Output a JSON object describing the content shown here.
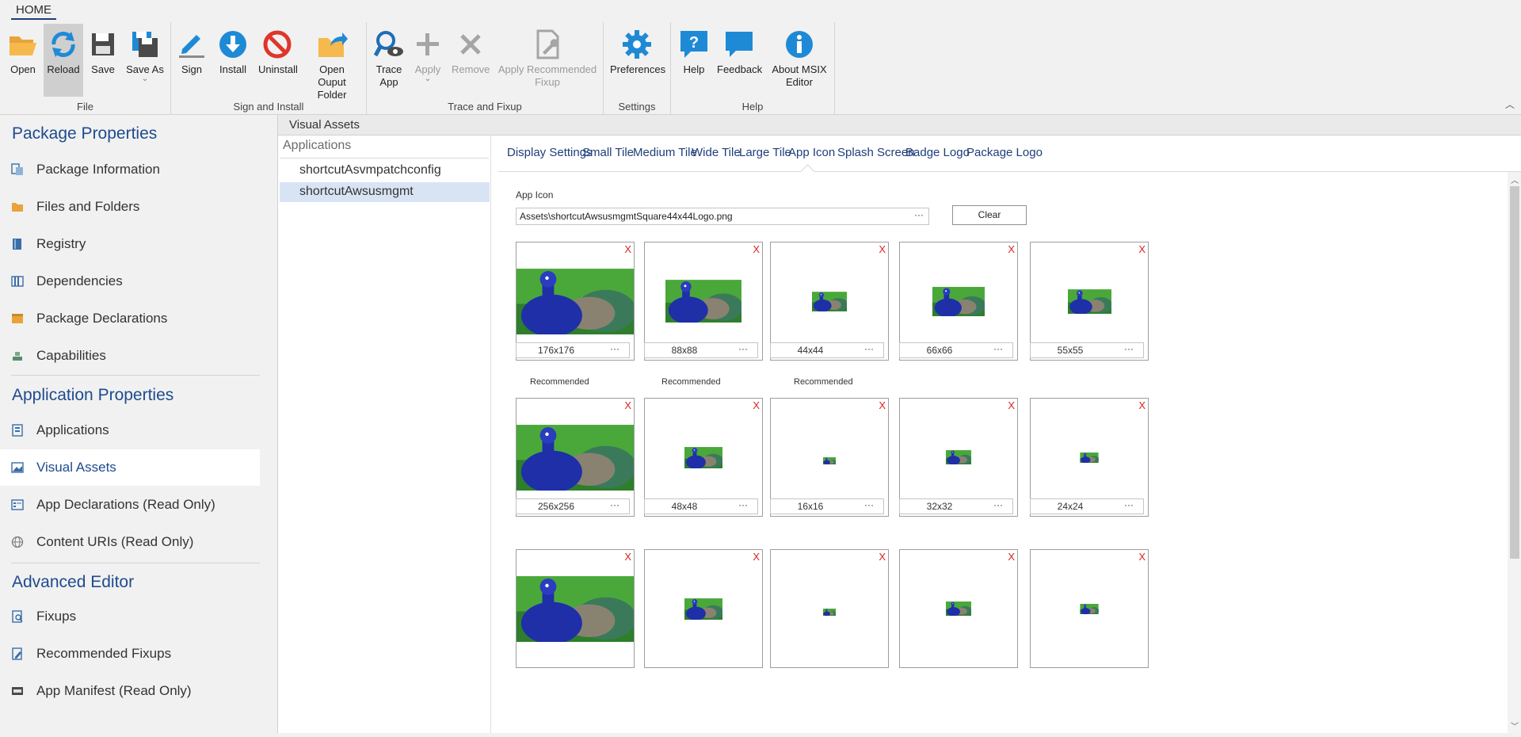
{
  "ribbon": {
    "tab": "HOME",
    "groups": {
      "file": {
        "label": "File",
        "open": "Open",
        "reload": "Reload",
        "save": "Save",
        "save_as": "Save As"
      },
      "sign_install": {
        "label": "Sign and Install",
        "sign": "Sign",
        "install": "Install",
        "uninstall": "Uninstall",
        "open_output_1": "Open Ouput",
        "open_output_2": "Folder"
      },
      "trace": {
        "label": "Trace and Fixup",
        "trace_1": "Trace",
        "trace_2": "App",
        "apply": "Apply",
        "remove": "Remove",
        "apply_rec_1": "Apply Recommended",
        "apply_rec_2": "Fixup"
      },
      "settings": {
        "label": "Settings",
        "preferences": "Preferences"
      },
      "help": {
        "label": "Help",
        "help": "Help",
        "feedback": "Feedback",
        "about_1": "About MSIX",
        "about_2": "Editor"
      }
    }
  },
  "nav": {
    "package_title": "Package Properties",
    "package_items": [
      "Package Information",
      "Files and Folders",
      "Registry",
      "Dependencies",
      "Package Declarations",
      "Capabilities"
    ],
    "application_title": "Application Properties",
    "application_items": [
      "Applications",
      "Visual Assets",
      "App Declarations (Read Only)",
      "Content URIs (Read Only)"
    ],
    "advanced_title": "Advanced Editor",
    "advanced_items": [
      "Fixups",
      "Recommended Fixups",
      "App Manifest (Read Only)"
    ]
  },
  "main": {
    "header": "Visual Assets",
    "apps_header": "Applications",
    "apps": [
      "shortcutAsvmpatchconfig",
      "shortcutAwsusmgmt"
    ],
    "tabs": [
      "Display Settings",
      "Small Tile",
      "Medium Tile",
      "Wide Tile",
      "Large Tile",
      "App Icon",
      "Splash Screen",
      "Badge Logo",
      "Package Logo"
    ],
    "active_tab": "App Icon",
    "field_label": "App Icon",
    "path": "Assets\\shortcutAwsusmgmtSquare44x44Logo.png",
    "path_dots": "···",
    "clear": "Clear",
    "x_mark": "X",
    "row1_sizes": [
      "176x176",
      "88x88",
      "44x44",
      "66x66",
      "55x55"
    ],
    "recommended": "Recommended",
    "row2_sizes": [
      "256x256",
      "48x48",
      "16x16",
      "32x32",
      "24x24"
    ]
  },
  "colors": {
    "accent": "#1e4b8f",
    "selected_app": "#d8e4f4",
    "close_x": "#e02020"
  }
}
